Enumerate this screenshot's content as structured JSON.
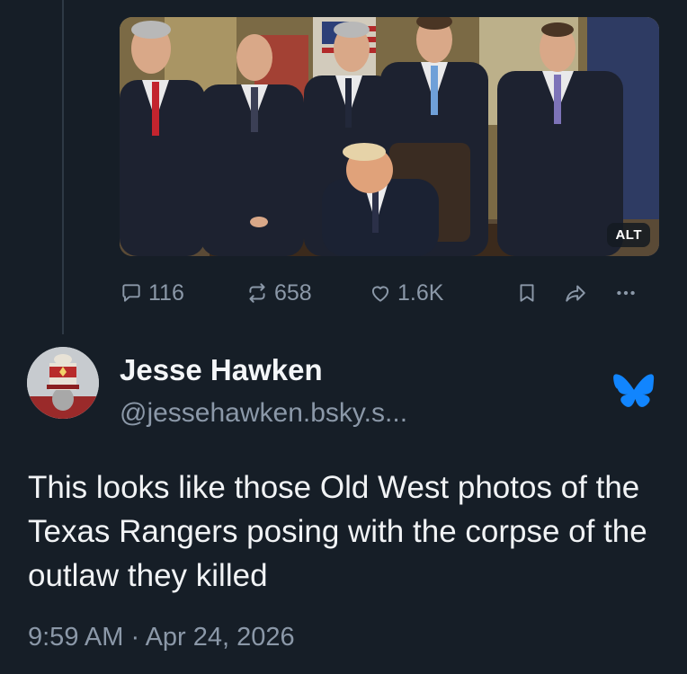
{
  "post_image": {
    "alt_label": "ALT"
  },
  "actions": {
    "reply_count": "116",
    "repost_count": "658",
    "like_count": "1.6K"
  },
  "quoted_post": {
    "display_name": "Jesse Hawken",
    "handle": "@jessehawken.bsky.s...",
    "text": "This looks like those Old West photos of the Texas Rangers posing with the corpse of the outlaw they killed",
    "timestamp": "9:59 AM · Apr 24, 2026"
  },
  "icons": {
    "reply": "speech-bubble-icon",
    "repost": "repost-arrows-icon",
    "like": "heart-icon",
    "bookmark": "bookmark-icon",
    "share": "share-arrow-icon",
    "more": "more-dots-icon",
    "network": "butterfly-icon"
  },
  "colors": {
    "background": "#161e27",
    "muted_text": "#8b98a8",
    "primary_text": "#f1f3f5",
    "brand_blue": "#1185fe"
  }
}
